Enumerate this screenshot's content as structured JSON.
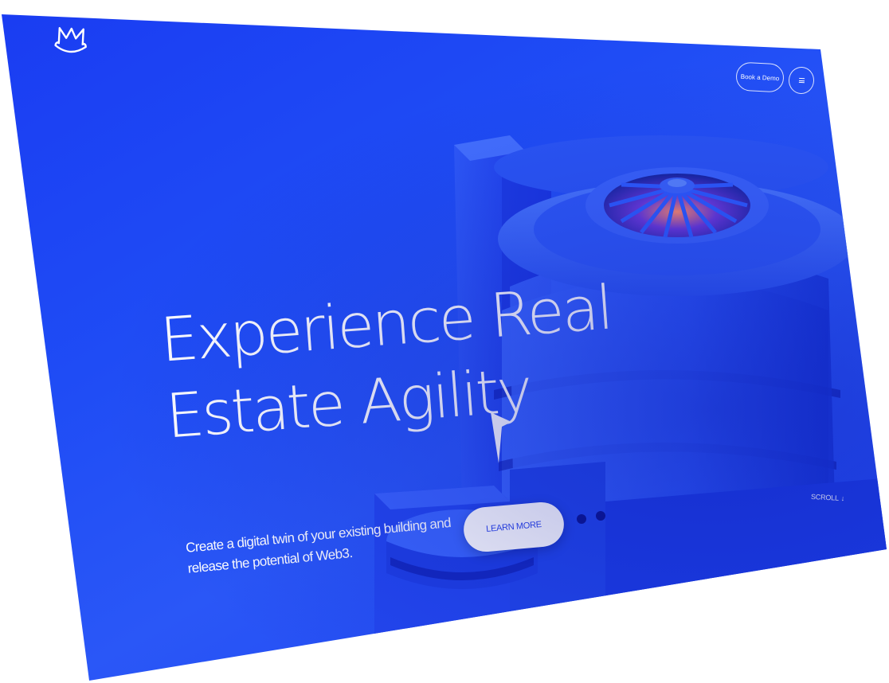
{
  "header": {
    "logo_icon": "m-crown-logo-icon",
    "book_demo_label": "Book a Demo",
    "menu_icon": "hamburger-menu-icon"
  },
  "hero": {
    "headline_line1": "Experience Real",
    "headline_line2": "Estate Agility",
    "subtitle_line1": "Create a digital twin of your existing building and",
    "subtitle_line2": "release the potential of Web3.",
    "cta_label": "LEARN MORE",
    "scroll_label": "SCROLL",
    "scroll_icon": "arrow-down-icon"
  },
  "colors": {
    "background": "#1f4cf5",
    "text": "#ffffff",
    "cta_text": "#2a44e8"
  }
}
